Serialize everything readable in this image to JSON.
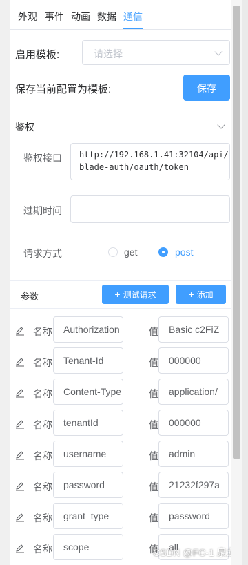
{
  "tabs": [
    "外观",
    "事件",
    "动画",
    "数据",
    "通信"
  ],
  "active_tab": "通信",
  "template": {
    "enable_label": "启用模板:",
    "select_placeholder": "请选择",
    "save_label": "保存当前配置为模板:",
    "save_button": "保存"
  },
  "auth": {
    "section_title": "鉴权",
    "url_label": "鉴权接口",
    "url_value": "http://192.168.1.41:32104/api/blade-auth/oauth/token",
    "expire_label": "过期时间",
    "expire_value": "",
    "method_label": "请求方式",
    "methods": [
      {
        "label": "get",
        "checked": false
      },
      {
        "label": "post",
        "checked": true
      }
    ]
  },
  "params": {
    "title": "参数",
    "test_button": "测试请求",
    "add_button": "添加",
    "name_label": "名称",
    "value_label": "值",
    "rows": [
      {
        "name": "Authorization",
        "value": "Basic c2FiZ"
      },
      {
        "name": "Tenant-Id",
        "value": "000000"
      },
      {
        "name": "Content-Type",
        "value": "application/"
      },
      {
        "name": "tenantId",
        "value": "000000"
      },
      {
        "name": "username",
        "value": "admin"
      },
      {
        "name": "password",
        "value": "21232f297a"
      },
      {
        "name": "grant_type",
        "value": "password"
      },
      {
        "name": "scope",
        "value": "all"
      }
    ]
  },
  "watermark": "CSDN @FC-1 泉龙",
  "colors": {
    "accent": "#409eff",
    "border": "#dcdfe6",
    "text": "#606266"
  }
}
